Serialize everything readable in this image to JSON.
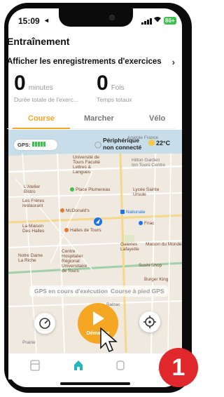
{
  "status_bar": {
    "time": "15:09",
    "location_glyph": "◂",
    "battery": "86+"
  },
  "header": {
    "title": "Entraînement",
    "records_link": "Afficher les enregistrements d'exercices",
    "records_chevron": "›"
  },
  "stats": {
    "duration": {
      "value": "0",
      "unit": "minutes",
      "label": "Durée totale de l'exerc..."
    },
    "times": {
      "value": "0",
      "unit": "Fois",
      "label": "Temps totaux"
    }
  },
  "tabs": [
    {
      "label": "Course",
      "active": true
    },
    {
      "label": "Marcher",
      "active": false
    },
    {
      "label": "Vélo",
      "active": false
    }
  ],
  "map": {
    "gps_label": "GPS:",
    "peripheral_line1": "Périphérique",
    "peripheral_line2": "non connecté",
    "temperature": "22°C",
    "labels": {
      "anatole_france": "Anatole France",
      "univ_tours_1": "Université de",
      "univ_tours_2": "Tours Faculté",
      "univ_tours_3": "Lettres &",
      "univ_tours_4": "Langues",
      "hilton_1": "Hilton Garden",
      "hilton_2": "Inn Tours Centre",
      "atelier_1": "L'Atelier",
      "atelier_2": "Bistro",
      "place_plumereau": "Place Plumereau",
      "lycee_1": "Lycée Sainte",
      "lycee_2": "Ursule",
      "freres_1": "Les Frères",
      "freres_2": "restaurant",
      "mcdonalds": "McDonald's",
      "nationale": "Nationale",
      "maison_1": "La Maison",
      "maison_2": "Des Halles",
      "halles": "Halles de Tours",
      "fnac": "Fnac",
      "notre_dame_1": "Notre Dame",
      "notre_dame_2": "La Riche",
      "chu_1": "Centre",
      "chu_2": "Hospitalier",
      "chu_3": "Régional",
      "chu_4": "Universitaire",
      "chu_5": "de Tours",
      "galeries_1": "Galeries",
      "galeries_2": "Lafayette",
      "maison_monde": "Maison du Monde",
      "sushi": "Sushi Shop",
      "burger_king": "Burger King",
      "balzac": "Balzac",
      "prairie": "Prairie"
    },
    "mode_pills": [
      "GPS en cours d'exécution",
      "Course à pied GPS"
    ]
  },
  "actions": {
    "start_label": "Démarrer"
  },
  "overlay": {
    "step_number": "1"
  },
  "colors": {
    "accent": "#f5a623",
    "battery": "#3ec04f",
    "badge": "#e0282c"
  }
}
